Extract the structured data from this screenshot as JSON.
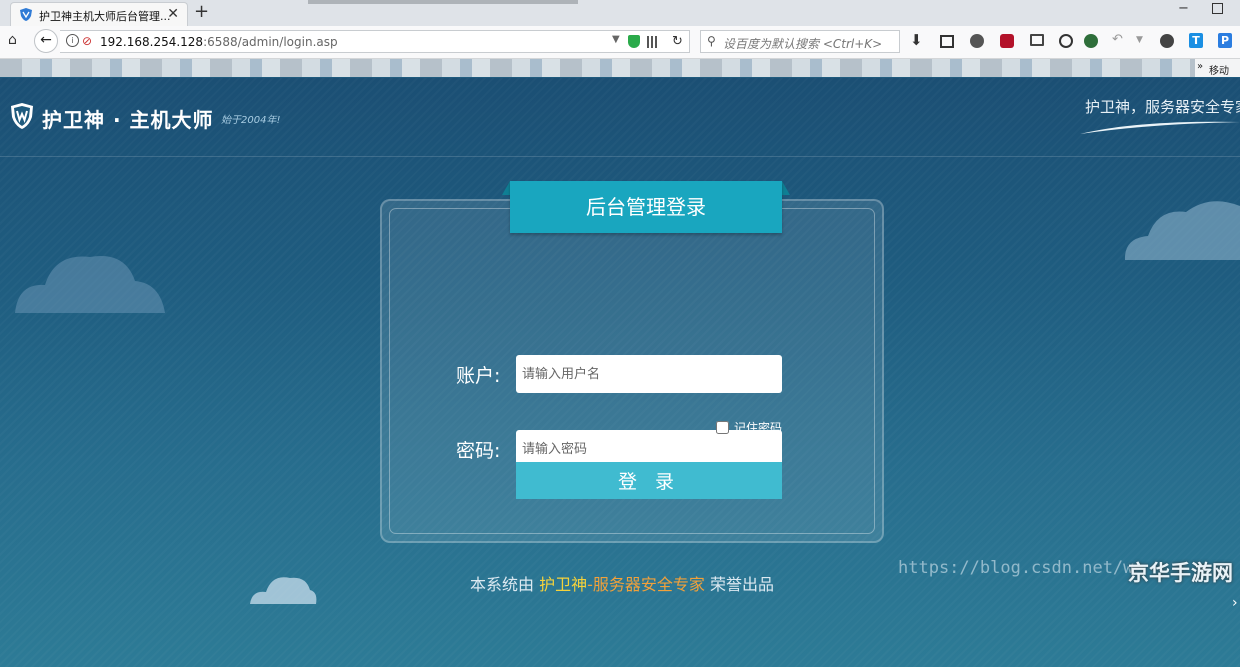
{
  "browser": {
    "tab_title": "护卫神主机大师后台管理...",
    "new_tab_label": "+",
    "window_minimize": "−",
    "url_host": "192.168.254.128",
    "url_rest": ":6588/admin/login.asp",
    "search_placeholder": "设百度为默认搜索 <Ctrl+K>",
    "bookmarks_more": "»",
    "bookmarks_more_label": "移动"
  },
  "header": {
    "brand": "护卫神 · 主机大师",
    "since": "始于2004年!",
    "slogan": "护卫神，服务器安全专家"
  },
  "login": {
    "title": "后台管理登录",
    "account_label": "账户:",
    "account_placeholder": "请输入用户名",
    "password_label": "密码:",
    "password_placeholder": "请输入密码",
    "remember_label": "记住密码",
    "submit_label": "登 录"
  },
  "footer": {
    "prefix": "本系统由 ",
    "highlight1": "护卫神",
    "highlight2": "-服务器安全专家",
    "suffix": " 荣誉出品"
  },
  "watermark": {
    "url": "https://blog.csdn.net/w",
    "site": "京华手游网"
  },
  "colors": {
    "page_bg": "#1f5b7e",
    "ribbon": "#19a6bf",
    "button": "#40bbd0",
    "footer_highlight": "#f5d23b"
  }
}
